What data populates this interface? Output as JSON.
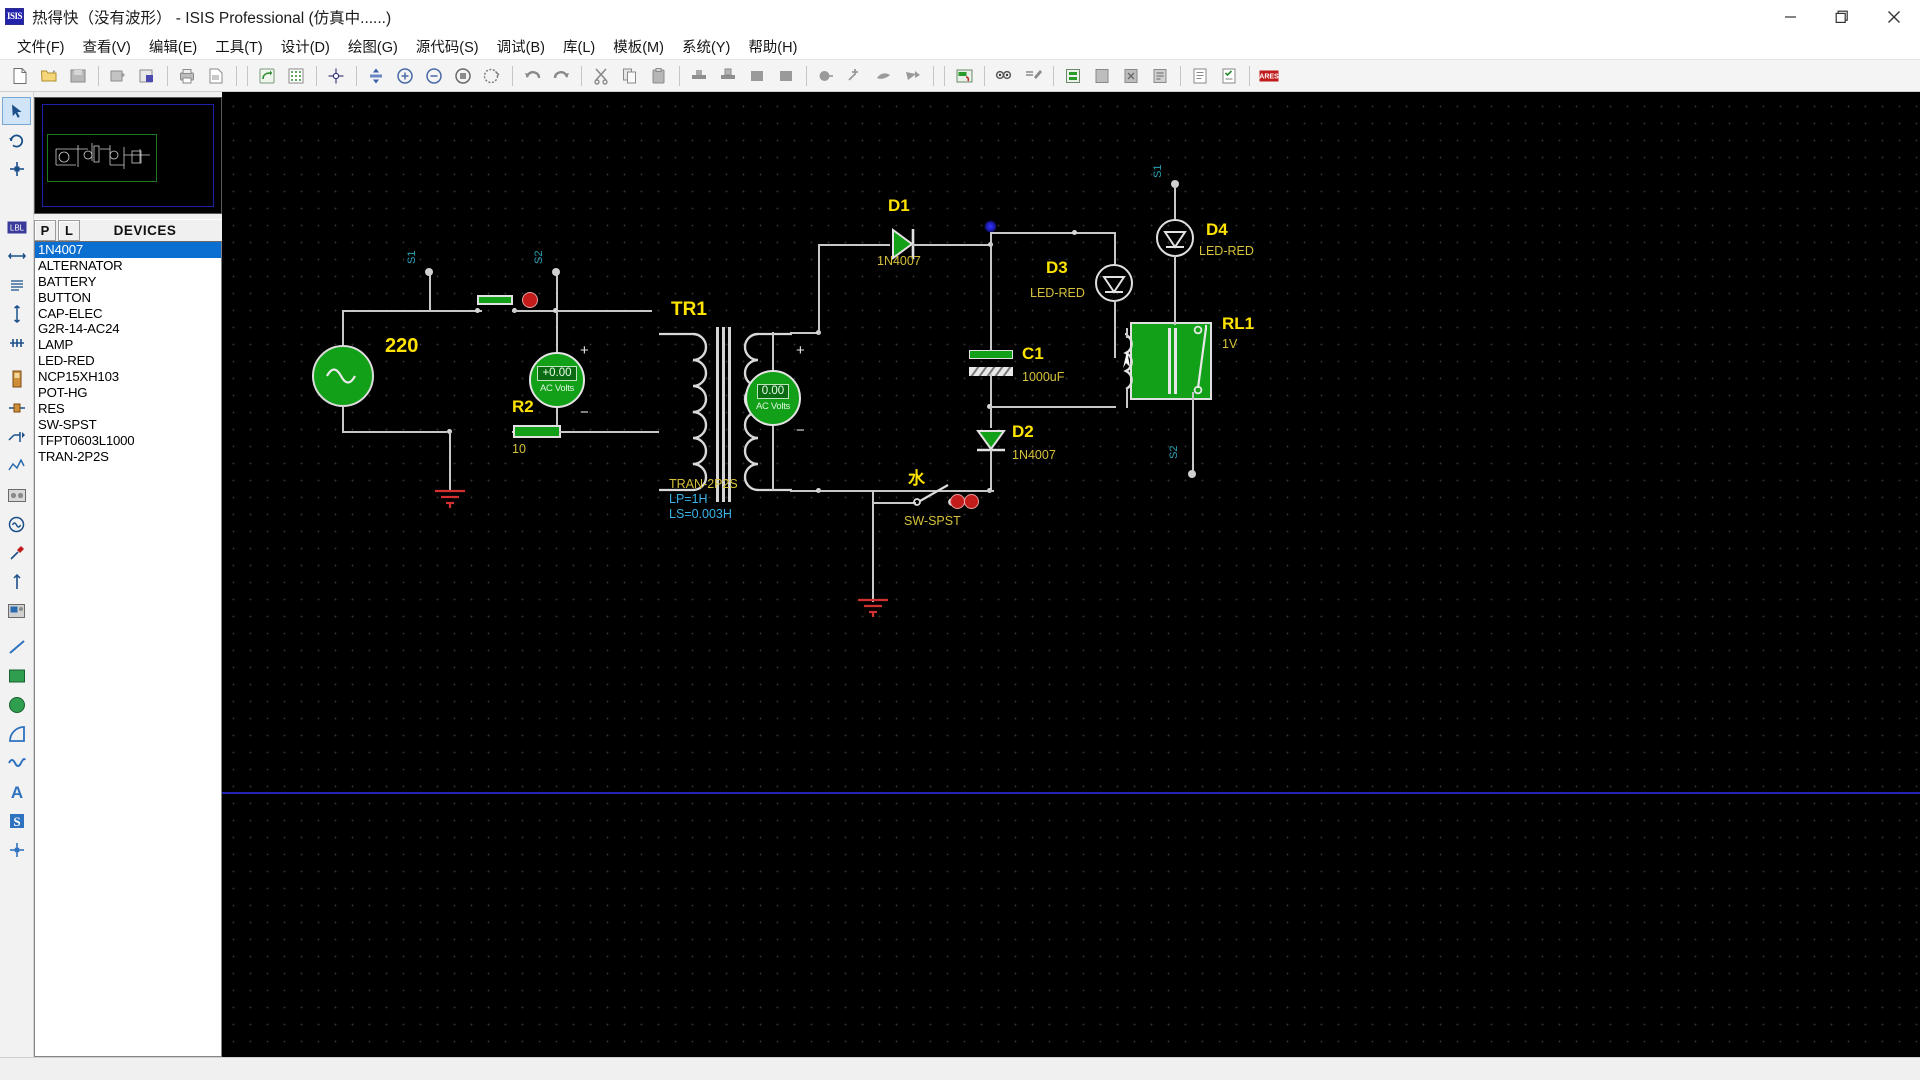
{
  "window": {
    "title": "热得快（没有波形）  - ISIS Professional (仿真中......)",
    "app_icon": "isis-icon",
    "minimize_label": "—",
    "maximize_label": "❐",
    "close_label": "✕"
  },
  "menubar": {
    "items": [
      {
        "label": "文件(F)",
        "name": "menu-file"
      },
      {
        "label": "查看(V)",
        "name": "menu-view"
      },
      {
        "label": "编辑(E)",
        "name": "menu-edit"
      },
      {
        "label": "工具(T)",
        "name": "menu-tools"
      },
      {
        "label": "设计(D)",
        "name": "menu-design"
      },
      {
        "label": "绘图(G)",
        "name": "menu-graph"
      },
      {
        "label": "源代码(S)",
        "name": "menu-source"
      },
      {
        "label": "调试(B)",
        "name": "menu-debug"
      },
      {
        "label": "库(L)",
        "name": "menu-library"
      },
      {
        "label": "模板(M)",
        "name": "menu-template"
      },
      {
        "label": "系统(Y)",
        "name": "menu-system"
      },
      {
        "label": "帮助(H)",
        "name": "menu-help"
      }
    ]
  },
  "toolbar": {
    "groups": [
      [
        "new-file-icon",
        "open-file-icon",
        "save-file-icon"
      ],
      [
        "import-section-icon",
        "export-section-icon"
      ],
      [
        "print-icon",
        "print-area-icon"
      ],
      [
        "refresh-display-icon",
        "toggle-grid-icon"
      ],
      [
        "origin-icon"
      ],
      [
        "pan-icon",
        "zoom-in-icon",
        "zoom-out-icon",
        "zoom-area-icon",
        "zoom-all-icon",
        "zoom-selection-icon"
      ],
      [
        "undo-icon",
        "redo-icon"
      ],
      [
        "cut-icon",
        "copy-icon",
        "paste-icon"
      ],
      [
        "copy-block-icon",
        "move-block-icon",
        "rotate-block-icon",
        "delete-block-icon"
      ],
      [
        "pick-device-icon",
        "make-device-icon",
        "packaging-tool-icon",
        "decompose-icon"
      ],
      [
        "wire-label-icon",
        "property-assign-icon"
      ],
      [
        "design-explorer-icon",
        "new-sheet-icon",
        "remove-sheet-icon",
        "exit-sheet-icon"
      ],
      [
        "bill-of-materials-icon",
        "electrical-rules-icon"
      ],
      [
        "netlist-ares-icon"
      ]
    ]
  },
  "palette": {
    "items": [
      {
        "name": "selection-mode-icon",
        "glyph": "arrow",
        "selected": true
      },
      {
        "name": "component-mode-icon",
        "glyph": "comp"
      },
      {
        "name": "junction-dot-mode-icon",
        "glyph": "junction"
      },
      {
        "name": "wire-label-mode-icon",
        "glyph": "lbl",
        "label": "LBL"
      },
      {
        "name": "text-script-mode-icon",
        "glyph": "script"
      },
      {
        "name": "bus-mode-icon",
        "glyph": "bus"
      },
      {
        "name": "subcircuit-mode-icon",
        "glyph": "subckt"
      },
      {
        "name": "terminals-mode-icon",
        "glyph": "terminal"
      },
      {
        "name": "device-pin-mode-icon",
        "glyph": "pin"
      },
      {
        "name": "graph-mode-icon",
        "glyph": "graph"
      },
      {
        "name": "tape-recorder-mode-icon",
        "glyph": "tape"
      },
      {
        "name": "generator-mode-icon",
        "glyph": "generator"
      },
      {
        "name": "voltage-probe-mode-icon",
        "glyph": "vprobe"
      },
      {
        "name": "current-probe-mode-icon",
        "glyph": "iprobe"
      },
      {
        "name": "virtual-instrument-mode-icon",
        "glyph": "instrument"
      },
      {
        "name": "line-tool-icon",
        "glyph": "line"
      },
      {
        "name": "box-tool-icon",
        "glyph": "box"
      },
      {
        "name": "circle-tool-icon",
        "glyph": "circle"
      },
      {
        "name": "arc-tool-icon",
        "glyph": "arc"
      },
      {
        "name": "path-tool-icon",
        "glyph": "path"
      },
      {
        "name": "text-tool-icon",
        "glyph": "A",
        "label": "A"
      },
      {
        "name": "symbol-tool-icon",
        "glyph": "S",
        "label": "S"
      },
      {
        "name": "marker-tool-icon",
        "glyph": "marker"
      }
    ],
    "rotation_tools": [
      {
        "name": "rotate-clockwise-icon"
      },
      {
        "name": "rotate-anticlockwise-icon"
      },
      {
        "name": "mirror-horizontal-icon"
      },
      {
        "name": "mirror-vertical-icon"
      }
    ],
    "rotation_value": "0"
  },
  "devices_panel": {
    "p_button": "P",
    "l_button": "L",
    "header": "DEVICES",
    "selected": "1N4007",
    "items": [
      "1N4007",
      "ALTERNATOR",
      "BATTERY",
      "BUTTON",
      "CAP-ELEC",
      "G2R-14-AC24",
      "LAMP",
      "LED-RED",
      "NCP15XH103",
      "POT-HG",
      "RES",
      "SW-SPST",
      "TFPT0603L1000",
      "TRAN-2P2S"
    ]
  },
  "schematic": {
    "source": {
      "value": "220",
      "name": "ac-source-v1"
    },
    "meter_primary": {
      "reading": "+0.00",
      "unit": "AC Volts"
    },
    "meter_secondary": {
      "reading": "0.00",
      "unit": "AC Volts"
    },
    "components": [
      {
        "ref": "R2",
        "value": "10",
        "name": "resistor-r2"
      },
      {
        "ref": "TR1",
        "value": "TRAN-2P2S",
        "name": "transformer-tr1",
        "param1": "LP=1H",
        "param2": "LS=0.003H"
      },
      {
        "ref": "D1",
        "value": "1N4007",
        "name": "diode-d1"
      },
      {
        "ref": "D2",
        "value": "1N4007",
        "name": "diode-d2"
      },
      {
        "ref": "D3",
        "value": "LED-RED",
        "name": "led-d3"
      },
      {
        "ref": "D4",
        "value": "LED-RED",
        "name": "led-d4"
      },
      {
        "ref": "C1",
        "value": "1000uF",
        "name": "capacitor-c1"
      },
      {
        "ref": "RL1",
        "value": "1V",
        "name": "relay-rl1"
      },
      {
        "ref": "",
        "value": "SW-SPST",
        "name": "switch-sw-spst"
      }
    ],
    "switch_label_cn": "水",
    "terminals": [
      {
        "label": "S1",
        "name": "terminal-s1-left"
      },
      {
        "label": "S2",
        "name": "terminal-s2-left"
      },
      {
        "label": "S1",
        "name": "terminal-s1-right"
      },
      {
        "label": "S2",
        "name": "terminal-s2-right"
      }
    ],
    "polarity_plus": "+",
    "polarity_minus": "−"
  }
}
